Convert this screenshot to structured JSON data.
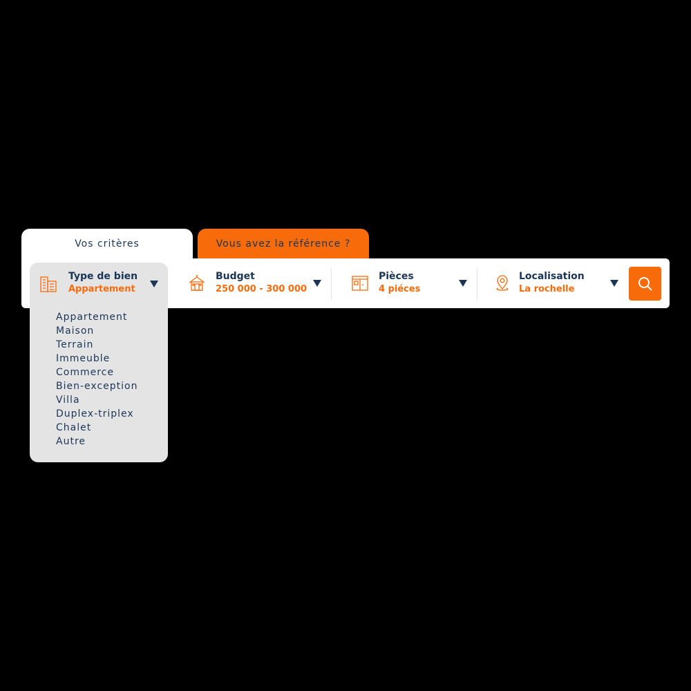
{
  "tabs": {
    "criteria_label": "Vos critères",
    "reference_label": "Vous avez la référence ?"
  },
  "fields": {
    "type": {
      "label": "Type de bien",
      "value": "Appartement",
      "icon": "building-icon"
    },
    "budget": {
      "label": "Budget",
      "value": "250 000 - 300 000",
      "icon": "house-icon"
    },
    "rooms": {
      "label": "Pièces",
      "value": "4 piéces",
      "icon": "room-icon"
    },
    "location": {
      "label": "Localisation",
      "value": "La rochelle",
      "icon": "map-pin-icon"
    }
  },
  "search": {
    "icon": "search-icon"
  },
  "type_options": [
    "Appartement",
    "Maison",
    "Terrain",
    "Immeuble",
    "Commerce",
    "Bien-exception",
    "Villa",
    "Duplex-triplex",
    "Chalet",
    "Autre"
  ],
  "colors": {
    "accent": "#f76b0a",
    "navy": "#1b3557",
    "background": "#000000",
    "panel": "#ffffff",
    "dropdown": "#e4e4e4"
  }
}
